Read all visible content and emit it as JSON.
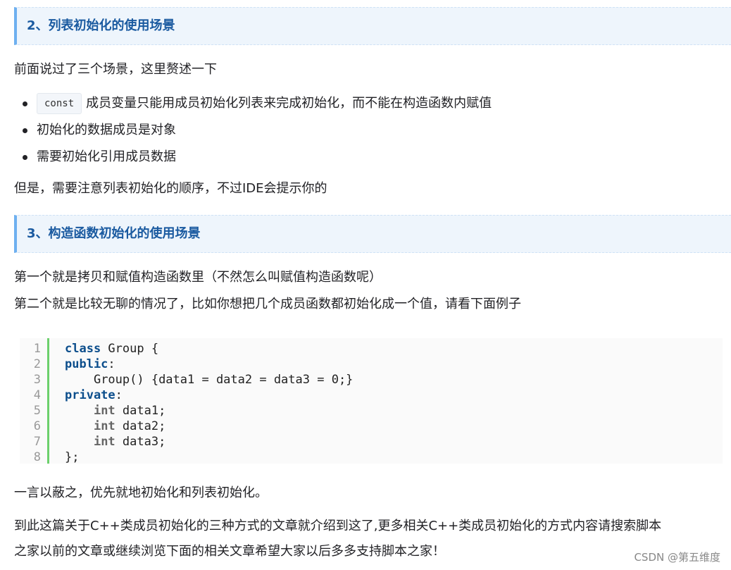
{
  "section2": {
    "heading": "2、列表初始化的使用场景",
    "intro": "前面说过了三个场景，这里赘述一下",
    "bullets": [
      {
        "code": "const",
        "text": "成员变量只能用成员初始化列表来完成初始化，而不能在构造函数内赋值"
      },
      {
        "text": "初始化的数据成员是对象"
      },
      {
        "text": "需要初始化引用成员数据"
      }
    ],
    "note": "但是，需要注意列表初始化的顺序，不过IDE会提示你的"
  },
  "section3": {
    "heading": "3、构造函数初始化的使用场景",
    "line1": "第一个就是拷贝和赋值构造函数里（不然怎么叫赋值构造函数呢）",
    "line2": "第二个就是比较无聊的情况了，比如你想把几个成员函数都初始化成一个值，请看下面例子"
  },
  "code_block": {
    "line_numbers": [
      "1",
      "2",
      "3",
      "4",
      "5",
      "6",
      "7",
      "8"
    ],
    "lines": [
      {
        "kw": "class",
        "rest": " Group {"
      },
      {
        "kw": "public",
        "rest": ":"
      },
      {
        "indent": "    ",
        "rest": "Group() {data1 = data2 = data3 = 0;}"
      },
      {
        "kw": "private",
        "rest": ":"
      },
      {
        "indent": "    ",
        "type": "int",
        "rest": " data1;"
      },
      {
        "indent": "    ",
        "type": "int",
        "rest": " data2;"
      },
      {
        "indent": "    ",
        "type": "int",
        "rest": " data3;"
      },
      {
        "rest": "};"
      }
    ]
  },
  "summary": "一言以蔽之，优先就地初始化和列表初始化。",
  "closing": {
    "line1": "到此这篇关于C++类成员初始化的三种方式的文章就介绍到这了,更多相关C++类成员初始化的方式内容请搜索脚本",
    "line2": "之家以前的文章或继续浏览下面的相关文章希望大家以后多多支持脚本之家！"
  },
  "watermark": "CSDN @第五维度"
}
